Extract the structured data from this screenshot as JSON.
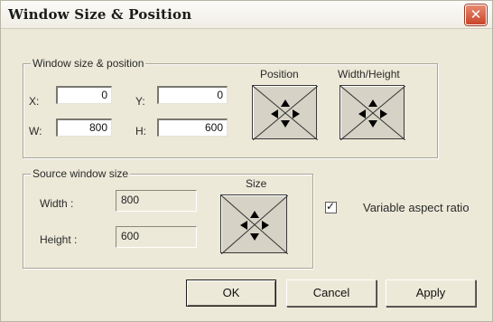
{
  "window": {
    "title": "Window Size & Position",
    "close_glyph": "✕"
  },
  "position_group": {
    "legend": "Window size & position",
    "x_label": "X:",
    "x_value": "0",
    "y_label": "Y:",
    "y_value": "0",
    "w_label": "W:",
    "w_value": "800",
    "h_label": "H:",
    "h_value": "600",
    "position_label": "Position",
    "position_pad_icon": "four-way-arrow-pad-icon",
    "width_height_label": "Width/Height",
    "width_height_pad_icon": "four-way-arrow-pad-icon"
  },
  "source_group": {
    "legend": "Source window size",
    "width_label": "Width :",
    "width_value": "800",
    "height_label": "Height :",
    "height_value": "600",
    "size_label": "Size",
    "size_pad_icon": "four-way-arrow-pad-icon"
  },
  "options": {
    "variable_aspect_label": "Variable aspect ratio",
    "variable_aspect_checked": true,
    "check_glyph": "✓"
  },
  "buttons": {
    "ok": "OK",
    "cancel": "Cancel",
    "apply": "Apply"
  },
  "colors": {
    "dialog_background": "#ece9d8",
    "close_button": "#c8452b",
    "pad_background": "#d6d3c6"
  }
}
